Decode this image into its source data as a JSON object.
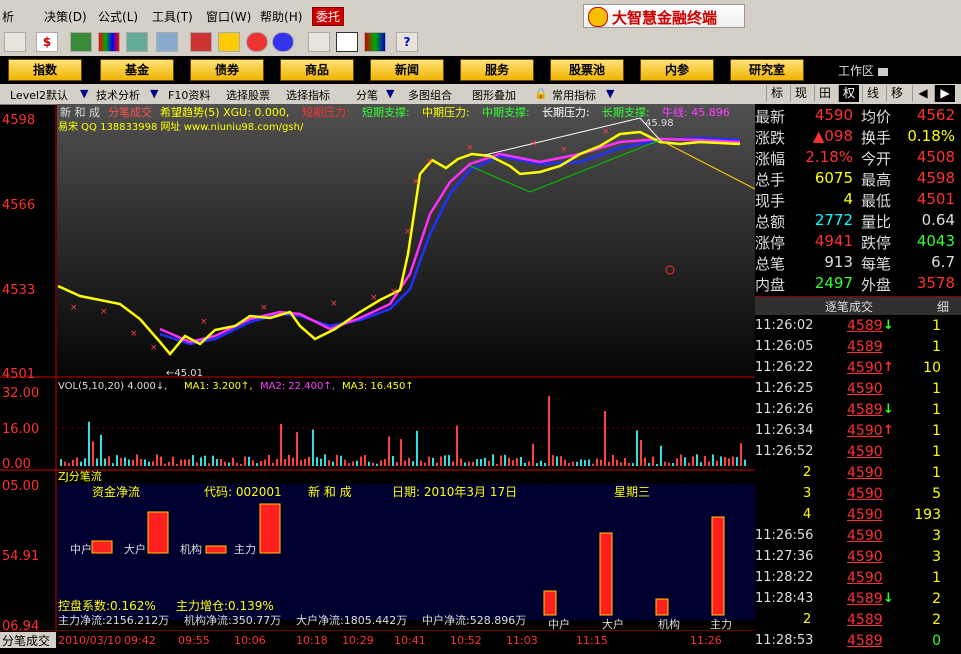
{
  "menu": {
    "items": [
      "析",
      "决策",
      "公式",
      "工具",
      "窗口",
      "帮助"
    ],
    "keys": [
      "",
      "(D)",
      "(L)",
      "(T)",
      "(W)",
      "(H)"
    ],
    "active": "委托",
    "brand": "大智慧金融终端"
  },
  "nav": {
    "buttons": [
      "指数",
      "基金",
      "债券",
      "商品",
      "新闻",
      "服务",
      "股票池",
      "内参",
      "研究室"
    ],
    "workspace": "工作区"
  },
  "subbar": {
    "items": [
      "Level2默认",
      "技术分析",
      "F10资料",
      "选择股票",
      "选择指标",
      "分笔",
      "多图组合",
      "图形叠加",
      "常用指标"
    ],
    "tabs": [
      "标",
      "现",
      "田",
      "权",
      "线",
      "移"
    ]
  },
  "chart": {
    "header_name": "新 和 成",
    "header_indicator": "分笔成交",
    "header_items": [
      "希望趋势(5) XGU: 0.000,",
      "短期压力:",
      "短期支撑:",
      "中期压力:",
      "中期支撑:",
      "长期压力:",
      "长期支撑:",
      "牛线: 45.896"
    ],
    "ad_text": "易宋 QQ 138833998 网址 www.niuniu98.com/gsh/",
    "price_ticks": [
      "4598",
      "4566",
      "4533",
      "4501"
    ],
    "high_label": "45.98",
    "low_label": "←45.01",
    "vol_legend": [
      "VOL(5,10,20) 4.000↓,",
      "MA1: 3.200↑,",
      "MA2: 22.400↑,",
      "MA3: 16.450↑"
    ],
    "vol_ticks": [
      "32.00",
      "16.00",
      "0.00"
    ],
    "flow_title": "ZJ分笔流",
    "flow_ticks": [
      "05.00",
      "54.91",
      "06.94"
    ],
    "flow_heading": {
      "title": "资金净流",
      "code_label": "代码: 002001",
      "name": "新 和 成",
      "date": "日期: 2010年3月 17日",
      "weekday": "星期三"
    },
    "flow_bars_labels": [
      "中户",
      "大户",
      "机构",
      "主力"
    ],
    "flow_bottom_labels": [
      "中户",
      "大户",
      "机构",
      "主力"
    ],
    "flow_stats": [
      "控盘系数:0.162%",
      "主力增仓:0.139%"
    ],
    "flow_net": [
      "主力净流:2156.212万",
      "机构净流:350.77万",
      "大户净流:1805.442万",
      "中户净流:528.896万"
    ],
    "time_axis": [
      "2010/03/10",
      "09:42",
      "09:55",
      "10:06",
      "10:18",
      "10:29",
      "10:41",
      "10:52",
      "11:03",
      "11:15",
      "11:26"
    ],
    "bottom_tab": "分笔成交"
  },
  "quote": {
    "rows": [
      {
        "l1": "最新",
        "v1": "4590",
        "c1": "#ff3030",
        "l2": "均价",
        "v2": "4562",
        "c2": "#ff3030"
      },
      {
        "l1": "涨跌",
        "v1": "▲098",
        "c1": "#ff3030",
        "l2": "换手",
        "v2": "0.18%",
        "c2": "#ffff00"
      },
      {
        "l1": "涨幅",
        "v1": "2.18%",
        "c1": "#ff3030",
        "l2": "今开",
        "v2": "4508",
        "c2": "#ff3030"
      },
      {
        "l1": "总手",
        "v1": "6075",
        "c1": "#ffff00",
        "l2": "最高",
        "v2": "4598",
        "c2": "#ff3030"
      },
      {
        "l1": "现手",
        "v1": "4",
        "c1": "#ffff00",
        "l2": "最低",
        "v2": "4501",
        "c2": "#ff3030"
      },
      {
        "l1": "总额",
        "v1": "2772",
        "c1": "#00ffff",
        "l2": "量比",
        "v2": "0.64",
        "c2": "#ddd"
      },
      {
        "l1": "涨停",
        "v1": "4941",
        "c1": "#ff3030",
        "l2": "跌停",
        "v2": "4043",
        "c2": "#30ff30"
      },
      {
        "l1": "总笔",
        "v1": "913",
        "c1": "#ddd",
        "l2": "每笔",
        "v2": "6.7",
        "c2": "#ddd"
      },
      {
        "l1": "内盘",
        "v1": "2497",
        "c1": "#30ff30",
        "l2": "外盘",
        "v2": "3578",
        "c2": "#ff3030"
      }
    ],
    "ticks_title": "逐笔成交",
    "ticks_tab": "细",
    "ticks": [
      {
        "time": "11:26:02",
        "price": "4589",
        "arrow": "↓",
        "vol": "1"
      },
      {
        "time": "11:26:05",
        "price": "4589",
        "arrow": "",
        "vol": "1"
      },
      {
        "time": "11:26:22",
        "price": "4590",
        "arrow": "↑",
        "vol": "10"
      },
      {
        "time": "11:26:25",
        "price": "4590",
        "arrow": "",
        "vol": "1"
      },
      {
        "time": "11:26:26",
        "price": "4589",
        "arrow": "↓",
        "vol": "1"
      },
      {
        "time": "11:26:34",
        "price": "4590",
        "arrow": "↑",
        "vol": "1"
      },
      {
        "time": "11:26:52",
        "price": "4590",
        "arrow": "",
        "vol": "1"
      },
      {
        "time": "2",
        "price": "4590",
        "arrow": "",
        "vol": "1"
      },
      {
        "time": "3",
        "price": "4590",
        "arrow": "",
        "vol": "5"
      },
      {
        "time": "4",
        "price": "4590",
        "arrow": "",
        "vol": "193"
      },
      {
        "time": "11:26:56",
        "price": "4590",
        "arrow": "",
        "vol": "3"
      },
      {
        "time": "11:27:36",
        "price": "4590",
        "arrow": "",
        "vol": "3"
      },
      {
        "time": "11:28:22",
        "price": "4590",
        "arrow": "",
        "vol": "1"
      },
      {
        "time": "11:28:43",
        "price": "4589",
        "arrow": "↓",
        "vol": "2"
      },
      {
        "time": "2",
        "price": "4589",
        "arrow": "",
        "vol": "2"
      },
      {
        "time": "11:28:53",
        "price": "4589",
        "arrow": "",
        "vol": "0"
      }
    ]
  }
}
